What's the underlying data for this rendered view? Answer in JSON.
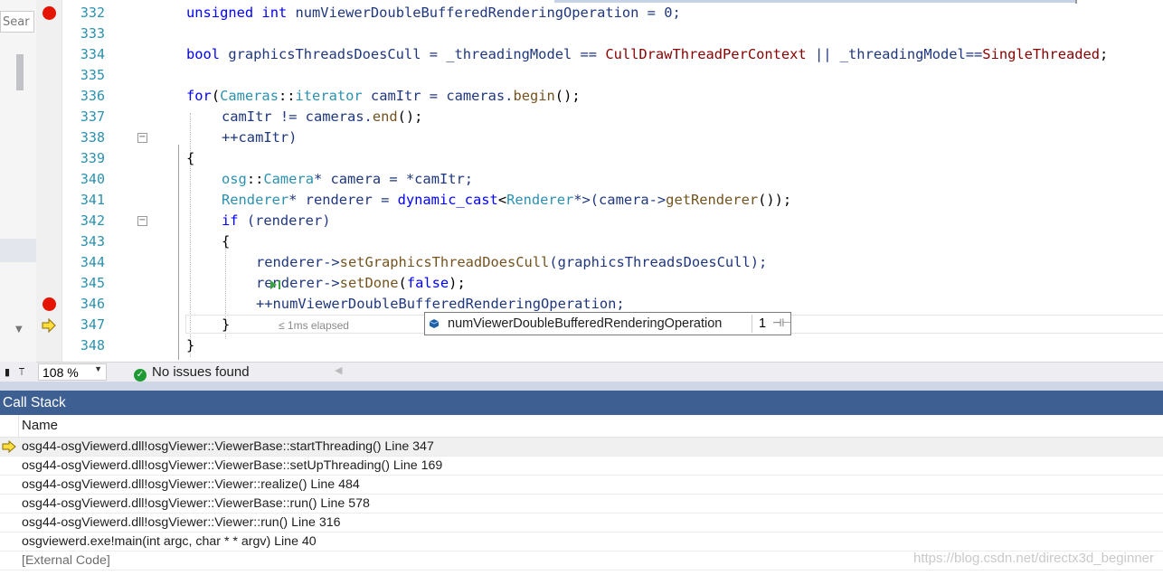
{
  "left_panel": {
    "search_placeholder": "Sear"
  },
  "editor": {
    "lines": [
      {
        "num": "332",
        "bp": true
      },
      {
        "num": "333"
      },
      {
        "num": "334"
      },
      {
        "num": "335"
      },
      {
        "num": "336"
      },
      {
        "num": "337"
      },
      {
        "num": "338"
      },
      {
        "num": "339"
      },
      {
        "num": "340"
      },
      {
        "num": "341"
      },
      {
        "num": "342"
      },
      {
        "num": "343"
      },
      {
        "num": "344"
      },
      {
        "num": "345"
      },
      {
        "num": "346",
        "bp": true
      },
      {
        "num": "347",
        "ip": true
      },
      {
        "num": "348"
      }
    ],
    "code": {
      "l332": [
        "unsigned",
        " ",
        "int",
        " numViewerDoubleBufferedRenderingOperation = 0;"
      ],
      "l334": [
        "bool",
        " graphicsThreadsDoesCull = _threadingModel == ",
        "CullDrawThreadPerContext",
        " || _threadingModel==",
        "SingleThreaded",
        ";"
      ],
      "l336": [
        "for",
        "(",
        "Cameras",
        "::",
        "iterator",
        " camItr = cameras.",
        "begin",
        "();"
      ],
      "l337": [
        "camItr",
        " != cameras.",
        "end",
        "();"
      ],
      "l338": [
        "++camItr)"
      ],
      "l339": [
        "{"
      ],
      "l340": [
        "osg",
        "::",
        "Camera",
        "* camera = *camItr;"
      ],
      "l341": [
        "Renderer",
        "* renderer = ",
        "dynamic_cast",
        "<",
        "Renderer",
        "*>(camera->",
        "getRenderer",
        "());"
      ],
      "l342": [
        "if",
        " (renderer)"
      ],
      "l343": [
        "{"
      ],
      "l344": [
        "renderer->",
        "setGraphicsThreadDoesCull",
        "(graphicsThreadsDoesCull);"
      ],
      "l345": [
        "renderer->",
        "setDone",
        "(",
        "false",
        ");"
      ],
      "l346": [
        "++numViewerDoubleBufferedRenderingOperation;"
      ],
      "l347": [
        "}"
      ],
      "l348": [
        "}"
      ]
    },
    "elapsed": "≤ 1ms elapsed",
    "datatip": {
      "name": "numViewerDoubleBufferedRenderingOperation",
      "value": "1"
    }
  },
  "statusbar": {
    "zoom": "108 %",
    "issues": "No issues found"
  },
  "call_stack": {
    "title": "Call Stack",
    "column_name": "Name",
    "rows": [
      {
        "text": "osg44-osgViewerd.dll!osgViewer::ViewerBase::startThreading() Line 347",
        "current": true
      },
      {
        "text": "osg44-osgViewerd.dll!osgViewer::ViewerBase::setUpThreading() Line 169"
      },
      {
        "text": "osg44-osgViewerd.dll!osgViewer::Viewer::realize() Line 484"
      },
      {
        "text": "osg44-osgViewerd.dll!osgViewer::ViewerBase::run() Line 578"
      },
      {
        "text": "osg44-osgViewerd.dll!osgViewer::Viewer::run() Line 316"
      },
      {
        "text": "osgviewerd.exe!main(int argc, char * * argv) Line 40"
      },
      {
        "text": "[External Code]",
        "external": true
      }
    ]
  },
  "watermark": "https://blog.csdn.net/directx3d_beginner",
  "colors": {
    "breakpoint": "#e51400",
    "keyword": "#0000ff",
    "type": "#2b91af",
    "function": "#74531f",
    "panel_title": "#3e5f92"
  }
}
